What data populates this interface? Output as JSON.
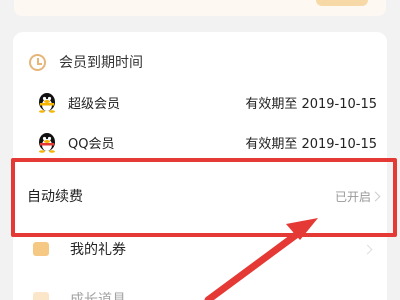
{
  "section": {
    "title": "会员到期时间",
    "icon": "clock-icon"
  },
  "members": [
    {
      "name": "超级会员",
      "expiry": "有效期至 2019-10-15",
      "icon": "qq-penguin-icon"
    },
    {
      "name": "QQ会员",
      "expiry": "有效期至 2019-10-15",
      "icon": "qq-penguin-icon"
    }
  ],
  "auto_renew": {
    "label": "自动续费",
    "status": "已开启"
  },
  "coupon": {
    "label": "我的礼券",
    "icon": "coupon-icon"
  },
  "growth": {
    "label": "成长道具",
    "icon": "gift-icon"
  },
  "colors": {
    "highlight": "#e53935",
    "accent_gold": "#e6b57a"
  }
}
